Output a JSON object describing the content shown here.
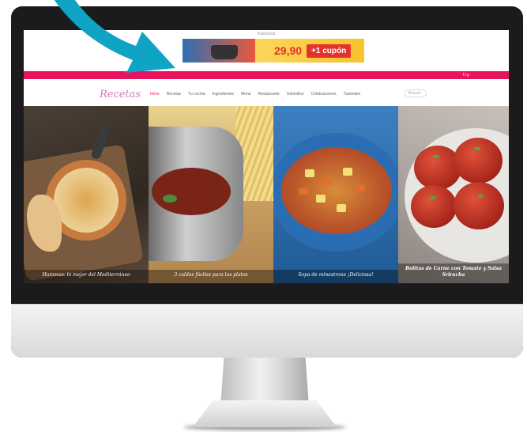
{
  "site": {
    "publicidad_label": "Publicidad",
    "banner": {
      "price": "29,90",
      "cupon": "+1 cupón"
    },
    "topbar": {
      "text": "",
      "icons": "f  t  p"
    },
    "logo": "Recetas",
    "nav": [
      "Inicio",
      "Recetas",
      "Tu cocina",
      "Ingredientes",
      "Menú",
      "Restaurante",
      "Utensilios",
      "Celebraciones",
      "Tutoriales"
    ],
    "search_placeholder": "Buscar",
    "cards": [
      {
        "caption": "Hummus: lo mejor del Mediterráneo"
      },
      {
        "caption": "3 caldos fáciles para los platos"
      },
      {
        "caption": "Sopa de minestrone ¡Deliciosa!"
      },
      {
        "caption": "Bolitas de Carne con Tomate y Salsa Sriracha"
      }
    ]
  },
  "colors": {
    "brand_pink": "#e8135e",
    "arrow": "#0fa3c4"
  }
}
